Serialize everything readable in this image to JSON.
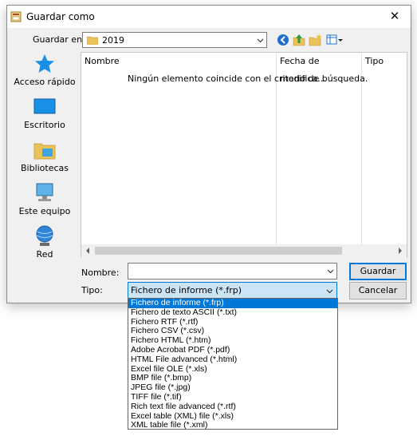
{
  "window": {
    "title": "Guardar como",
    "close_glyph": "✕"
  },
  "location": {
    "label": "Guardar en:",
    "value": "2019"
  },
  "toolbar": {
    "icons": [
      "back-icon",
      "up-folder-icon",
      "new-folder-icon",
      "view-menu-icon"
    ]
  },
  "places": [
    {
      "label": "Acceso rápido",
      "icon": "star-icon"
    },
    {
      "label": "Escritorio",
      "icon": "desktop-icon"
    },
    {
      "label": "Bibliotecas",
      "icon": "libraries-icon"
    },
    {
      "label": "Este equipo",
      "icon": "computer-icon"
    },
    {
      "label": "Red",
      "icon": "network-icon"
    }
  ],
  "filelist": {
    "columns": [
      "Nombre",
      "Fecha de modifica...",
      "Tipo"
    ],
    "empty_message": "Ningún elemento coincide con el criterio de búsqueda."
  },
  "form": {
    "name_label": "Nombre:",
    "name_value": "",
    "type_label": "Tipo:",
    "type_value": "Fichero de informe (*.frp)",
    "save_label": "Guardar",
    "cancel_label": "Cancelar"
  },
  "type_options": [
    "Fichero de informe (*.frp)",
    "Fichero de texto ASCII (*.txt)",
    "Fichero RTF (*.rtf)",
    "Fichero CSV (*.csv)",
    "Fichero HTML (*.htm)",
    "Adobe Acrobat PDF  (*.pdf)",
    "HTML File advanced (*.html)",
    "Excel file OLE (*.xls)",
    "BMP file (*.bmp)",
    "JPEG file (*.jpg)",
    "TIFF file (*.tif)",
    "Rich text file advanced (*.rtf)",
    "Excel table (XML) file (*.xls)",
    "XML table file (*.xml)"
  ],
  "colors": {
    "accent": "#0078d7",
    "selection_bg": "#cce4f7"
  }
}
